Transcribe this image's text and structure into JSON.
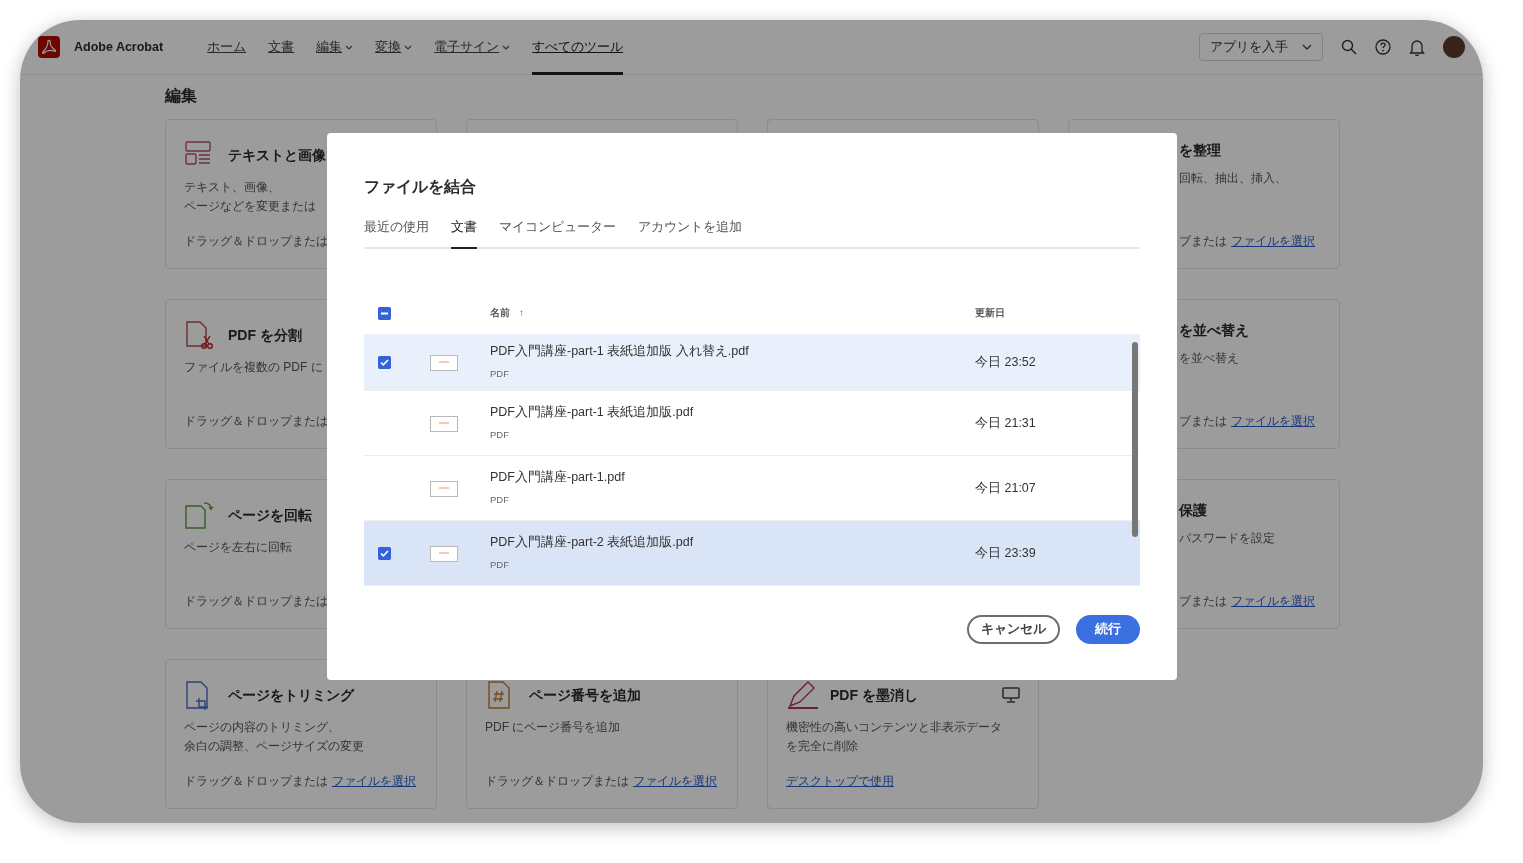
{
  "app": {
    "name": "Adobe Acrobat",
    "nav": [
      {
        "label": "ホーム",
        "dropdown": false,
        "selected": false
      },
      {
        "label": "文書",
        "dropdown": false,
        "selected": false
      },
      {
        "label": "編集",
        "dropdown": true,
        "selected": false
      },
      {
        "label": "変換",
        "dropdown": true,
        "selected": false
      },
      {
        "label": "電子サイン",
        "dropdown": true,
        "selected": false
      },
      {
        "label": "すべてのツール",
        "dropdown": false,
        "selected": true
      }
    ],
    "get_app": "アプリを入手"
  },
  "section_title": "編集",
  "tool_rows": [
    [
      {
        "kind": "tool",
        "title": "テキストと画像",
        "desc": [
          "テキスト、画像、",
          "ページなどを変更または"
        ],
        "drop_text": "ドラッグ＆ドロップまたは"
      },
      {
        "kind": "blank"
      },
      {
        "kind": "blank"
      },
      {
        "kind": "tool",
        "title": "を整理",
        "desc": [
          "回転、抽出、挿入、"
        ],
        "drop_text": "ブまたは",
        "link": "ファイルを選択"
      }
    ],
    [
      {
        "kind": "tool",
        "title": "PDF を分割",
        "desc": [
          "ファイルを複数の PDF に"
        ],
        "drop_text": "ドラッグ＆ドロップまたは"
      },
      {
        "kind": "blank"
      },
      {
        "kind": "blank"
      },
      {
        "kind": "tool",
        "title": "を並べ替え",
        "desc": [
          "を並べ替え"
        ],
        "drop_text": "ブまたは",
        "link": "ファイルを選択"
      }
    ],
    [
      {
        "kind": "tool",
        "title": "ページを回転",
        "desc": [
          "ページを左右に回転"
        ],
        "drop_text": "ドラッグ＆ドロップまたは"
      },
      {
        "kind": "blank"
      },
      {
        "kind": "blank"
      },
      {
        "kind": "tool",
        "title": "保護",
        "desc": [
          "パスワードを設定"
        ],
        "drop_text": "ブまたは",
        "link": "ファイルを選択"
      }
    ],
    [
      {
        "kind": "tool",
        "title": "ページをトリミング",
        "desc": [
          "ページの内容のトリミング、",
          "余白の調整、ページサイズの変更"
        ],
        "drop_text": "ドラッグ＆ドロップまたは",
        "link": "ファイルを選択"
      },
      {
        "kind": "tool",
        "title": "ページ番号を追加",
        "desc": [
          "PDF にページ番号を追加"
        ],
        "drop_text": "ドラッグ＆ドロップまたは",
        "link": "ファイルを選択"
      },
      {
        "kind": "tool",
        "title": "PDF を墨消し",
        "desktop": true,
        "desc": [
          "機密性の高いコンテンツと非表示データ",
          "を完全に削除"
        ],
        "link": "デスクトップで使用"
      }
    ]
  ],
  "dialog": {
    "title": "ファイルを結合",
    "tabs": [
      {
        "label": "最近の使用",
        "selected": false
      },
      {
        "label": "文書",
        "selected": true
      },
      {
        "label": "マイコンピューター",
        "selected": false
      },
      {
        "label": "アカウントを追加",
        "selected": false
      }
    ],
    "select_all": {
      "checked": true,
      "indeterminate": true
    },
    "columns": [
      {
        "label": "名前",
        "sort": "↑"
      },
      {
        "label": "更新日"
      }
    ],
    "rows": [
      {
        "name": "PDF入門講座-part-1 表紙追加版 入れ替え.pdf",
        "type": "PDF",
        "modified": "今日 23:52",
        "selected": true,
        "hovered": false
      },
      {
        "name": "PDF入門講座-part-1 表紙追加版.pdf",
        "type": "PDF",
        "modified": "今日 21:31",
        "selected": false,
        "hovered": false
      },
      {
        "name": "PDF入門講座-part-1.pdf",
        "type": "PDF",
        "modified": "今日 21:07",
        "selected": false,
        "hovered": false
      },
      {
        "name": "PDF入門講座-part-2 表紙追加版.pdf",
        "type": "PDF",
        "modified": "今日 23:39",
        "selected": true,
        "hovered": true
      }
    ],
    "buttons": [
      {
        "label": "キャンセル",
        "kind": "secondary"
      },
      {
        "label": "続行",
        "kind": "primary"
      }
    ]
  }
}
